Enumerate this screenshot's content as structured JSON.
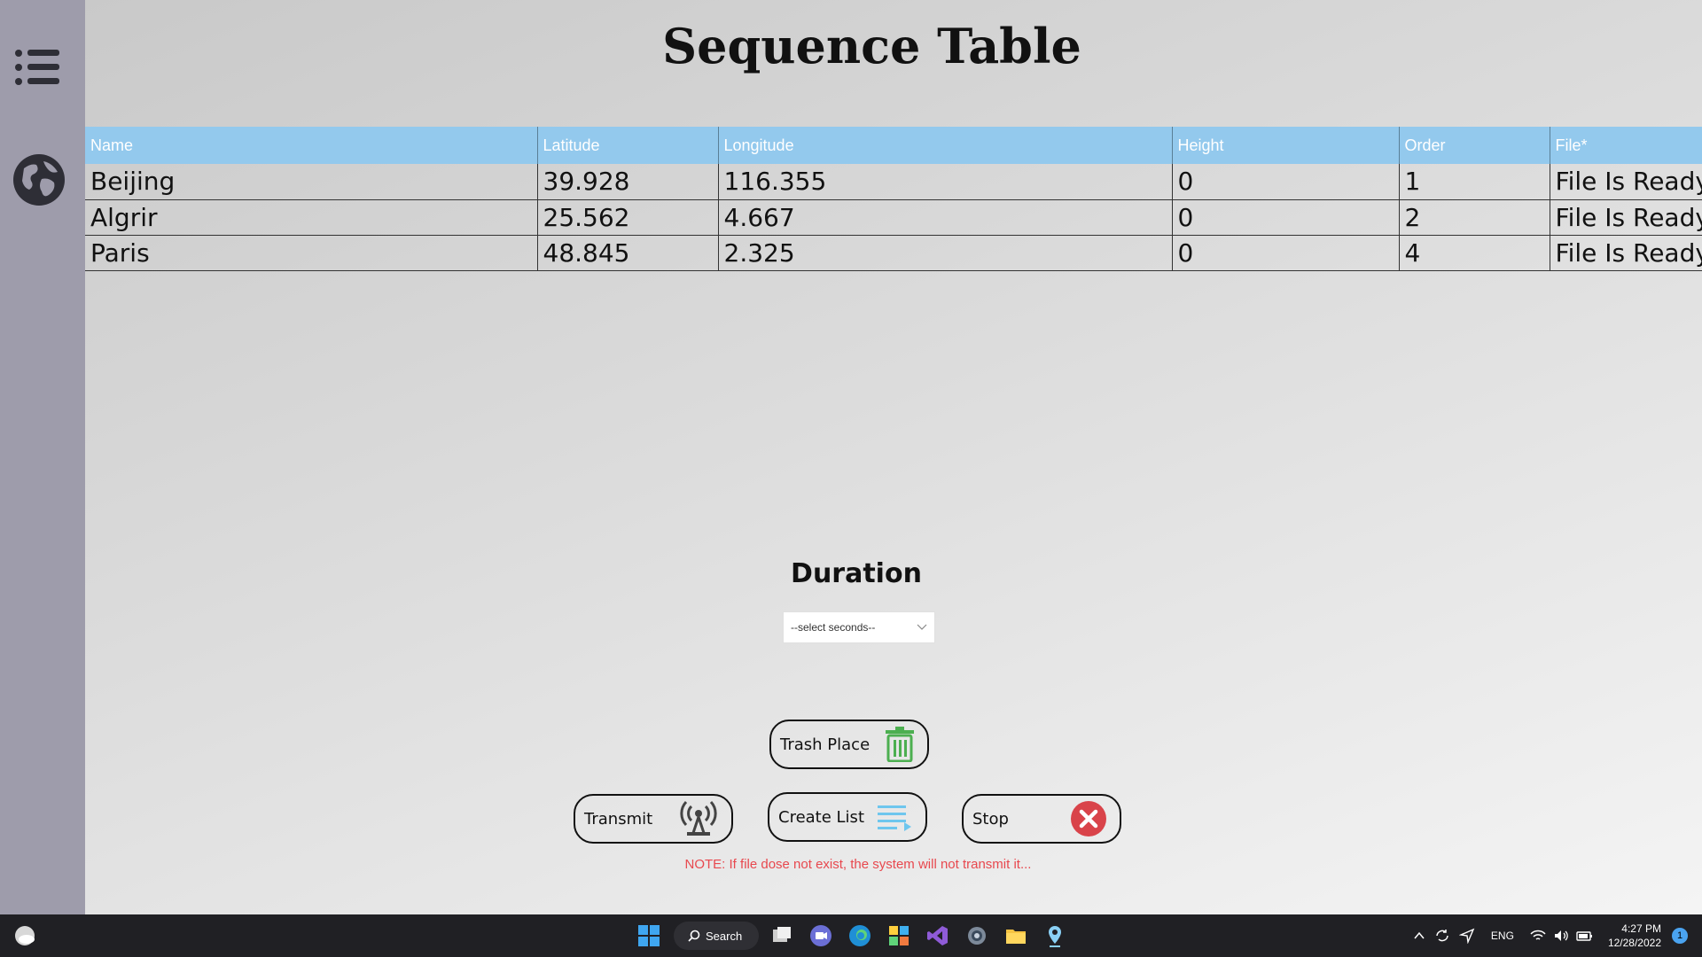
{
  "title": "Sequence Table",
  "table": {
    "headers": [
      "Name",
      "Latitude",
      "Longitude",
      "Height",
      "Order",
      "File*"
    ],
    "rows": [
      [
        "Beijing",
        "39.928",
        "116.355",
        "0",
        "1",
        "File Is Ready"
      ],
      [
        "Algrir",
        "25.562",
        "4.667",
        "0",
        "2",
        "File Is Ready"
      ],
      [
        "Paris",
        "48.845",
        "2.325",
        "0",
        "4",
        "File Is Ready"
      ]
    ]
  },
  "duration": {
    "title": "Duration",
    "select_value": "--select seconds--"
  },
  "buttons": {
    "trash": "Trash Place",
    "transmit": "Transmit",
    "create_list": "Create List",
    "stop": "Stop"
  },
  "note": "NOTE: If file dose not exist, the system will not transmit it...",
  "taskbar": {
    "search_label": "Search",
    "lang": "ENG",
    "time": "4:27 PM",
    "date": "12/28/2022",
    "notification_count": "1"
  },
  "colors": {
    "sidebar": "#9e9cab",
    "table_header": "#93c9ed",
    "note": "#e8484e",
    "trash_icon": "#4caf50",
    "create_icon": "#6ec6ee",
    "stop_icon": "#d9434a"
  },
  "icons": [
    "menu-icon",
    "globe-icon",
    "trash-icon",
    "antenna-icon",
    "list-icon",
    "close-circle-icon"
  ]
}
